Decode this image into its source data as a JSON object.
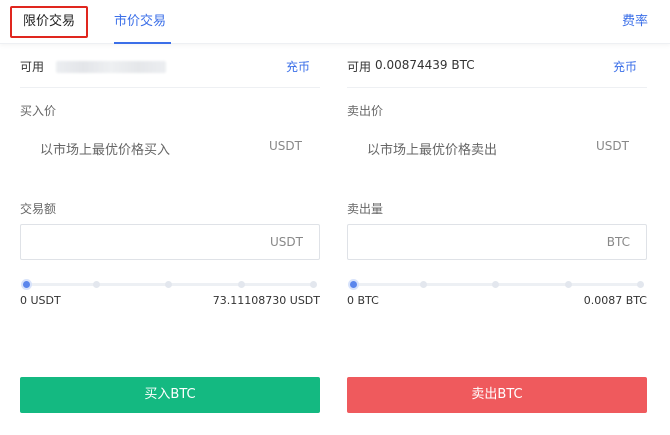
{
  "tabs": {
    "limit_label": "限价交易",
    "market_label": "市价交易",
    "fee_label": "费率"
  },
  "buy": {
    "available_label": "可用",
    "deposit_label": "充币",
    "price_label": "买入价",
    "price_placeholder": "以市场上最优价格买入",
    "price_unit": "USDT",
    "amount_label": "交易额",
    "amount_value": "",
    "amount_unit": "USDT",
    "slider_fraction": 0,
    "range_min": "0 USDT",
    "range_max": "73.11108730 USDT",
    "button_label": "买入BTC",
    "color": "#14b981"
  },
  "sell": {
    "available_label": "可用",
    "available_value": "0.00874439 BTC",
    "deposit_label": "充币",
    "price_label": "卖出价",
    "price_placeholder": "以市场上最优价格卖出",
    "price_unit": "USDT",
    "amount_label": "卖出量",
    "amount_value": "",
    "amount_unit": "BTC",
    "slider_fraction": 0,
    "range_min": "0 BTC",
    "range_max": "0.0087 BTC",
    "button_label": "卖出BTC",
    "color": "#ef5a5d"
  },
  "accent_color": "#3b6fe8"
}
